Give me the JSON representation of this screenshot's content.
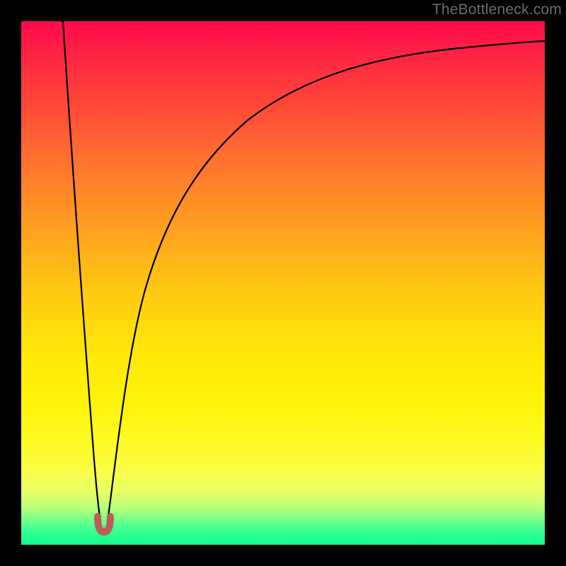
{
  "watermark": "TheBottleneck.com",
  "colors": {
    "frame": "#000000",
    "gradient_top": "#ff0a4a",
    "gradient_mid": "#fff208",
    "gradient_bottom": "#0aff8c",
    "curve": "#000000",
    "marker": "#bf5a58"
  },
  "chart_data": {
    "type": "line",
    "title": "",
    "xlabel": "",
    "ylabel": "",
    "xlim": [
      0,
      100
    ],
    "ylim": [
      0,
      100
    ],
    "grid": false,
    "legend": false,
    "notes": "Bottleneck / mismatch curve. Y-axis encodes bottleneck percentage (red≈100%, green≈0%); X-axis is relative component strength. Minimum (optimal pairing) near x≈15.5%. Gradient background is the same percentage color scale.",
    "series": [
      {
        "name": "left-branch",
        "x": [
          8,
          9,
          10,
          11,
          12,
          13,
          14,
          14.8
        ],
        "y": [
          100,
          86,
          72,
          58,
          44,
          30,
          16,
          6
        ]
      },
      {
        "name": "right-branch",
        "x": [
          16.2,
          17,
          18,
          20,
          23,
          27,
          32,
          38,
          45,
          53,
          62,
          72,
          83,
          95,
          100
        ],
        "y": [
          6,
          14,
          24,
          38,
          50,
          60,
          68,
          74.5,
          80,
          84,
          87.5,
          90.3,
          92.6,
          94.5,
          95.2
        ]
      },
      {
        "name": "minimum-marker",
        "x": [
          14.8,
          15.1,
          15.5,
          15.9,
          16.2
        ],
        "y": [
          6,
          3.5,
          3,
          3.5,
          6
        ]
      }
    ]
  }
}
